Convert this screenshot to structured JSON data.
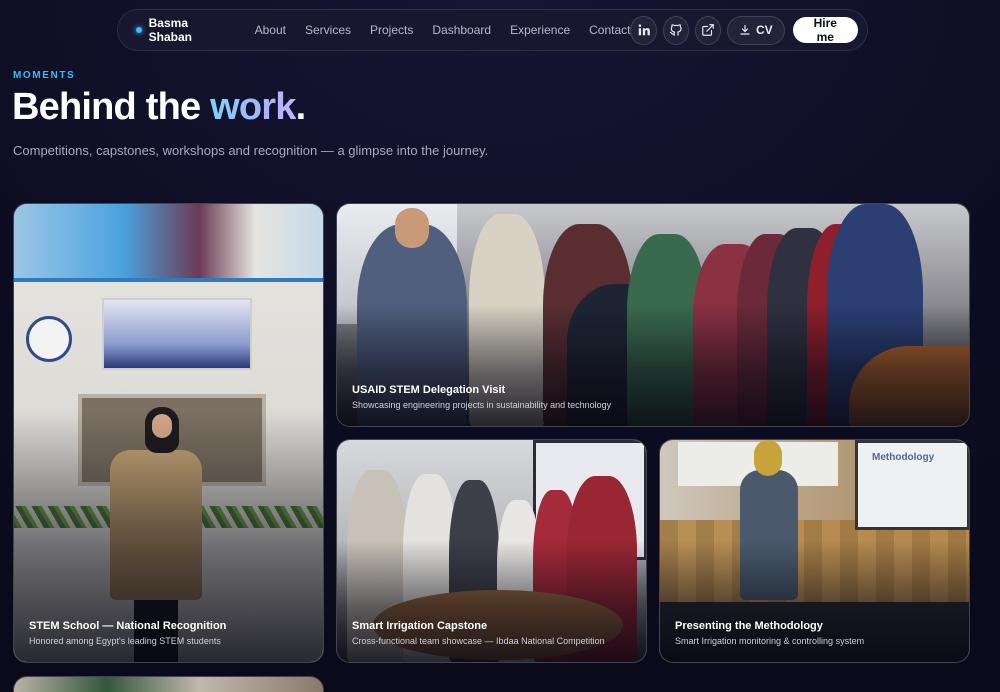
{
  "nav": {
    "brand": "Basma Shaban",
    "links": [
      {
        "label": "About"
      },
      {
        "label": "Services"
      },
      {
        "label": "Projects"
      },
      {
        "label": "Dashboard"
      },
      {
        "label": "Experience"
      },
      {
        "label": "Contact"
      }
    ],
    "cv_label": "CV",
    "hire_label": "Hire me",
    "icons": [
      "linkedin-icon",
      "github-icon",
      "external-link-icon",
      "download-icon"
    ]
  },
  "hero": {
    "eyebrow": "MOMENTS",
    "heading_plain": "Behind the ",
    "heading_accent": "work",
    "heading_end": ".",
    "subtitle": "Competitions, capstones, workshops and recognition — a glimpse into the journey."
  },
  "gallery": {
    "cards": [
      {
        "title": "STEM School — National Recognition",
        "desc": "Honored among Egypt's leading STEM students"
      },
      {
        "title": "USAID STEM Delegation Visit",
        "desc": "Showcasing engineering projects in sustainability and technology"
      },
      {
        "title": "Smart Irrigation Capstone",
        "desc": "Cross-functional team showcase — Ibdaa National Competition"
      },
      {
        "title": "Presenting the Methodology",
        "desc": "Smart Irrigation monitoring & controlling system"
      }
    ],
    "slide_text": "Methodology"
  },
  "colors": {
    "accent": "#38bdf8",
    "background": "#0d0d22",
    "hire_button": "#ffffff"
  }
}
